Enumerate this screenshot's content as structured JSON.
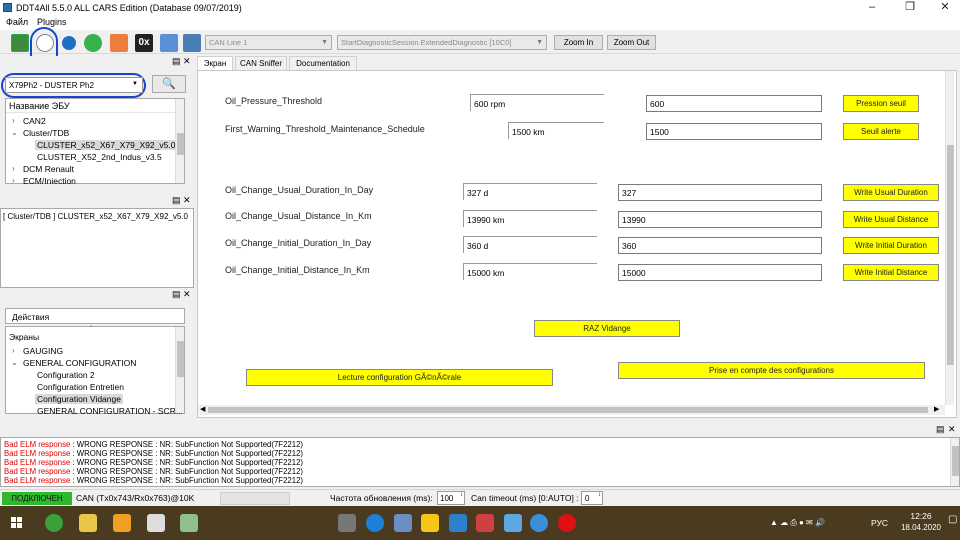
{
  "window": {
    "title": "DDT4All 5.5.0 ALL CARS Edition (Database 09/07/2019)"
  },
  "menu": {
    "file": "Файл",
    "plugins": "Plugins"
  },
  "toolbar": {
    "can_line": "CAN Line 1",
    "session": "StartDiagnosticSession.ExtendedDiagnostic [10C0]",
    "zoom_in": "Zoom In",
    "zoom_out": "Zoom Out",
    "hex_label": "0x"
  },
  "left": {
    "vehicle_select": "X79Ph2 - DUSTER Ph2",
    "ecu_header": "Название ЭБУ",
    "ecu_tree": [
      "CAN2",
      "Cluster/TDB",
      "CLUSTER_x52_X67_X79_X92_v5.0",
      "CLUSTER_X52_2nd_Indus_v3.5",
      "DCM Renault",
      "ECM/Injection"
    ],
    "selected_ecu": "[ Cluster/TDB ] CLUSTER_x52_X67_X79_X92_v5.0",
    "actions_header": "Действия",
    "screens_header": "Экраны",
    "screens": [
      "GAUGING",
      "GENERAL CONFIGURATION",
      "Configuration 2",
      "Configuration Entretien",
      "Configuration Vidange",
      "GENERAL CONFIGURATION - SCR..."
    ]
  },
  "tabs": [
    "Экран",
    "CAN Sniffer",
    "Documentation"
  ],
  "main": {
    "rows": [
      {
        "label": "Oil_Pressure_Threshold",
        "value": "600 rpm",
        "input": "600",
        "button": "Pression seuil"
      },
      {
        "label": "First_Warning_Threshold_Maintenance_Schedule",
        "value": "1500 km",
        "input": "1500",
        "button": "Seuil alerte"
      },
      {
        "label": "Oil_Change_Usual_Duration_In_Day",
        "value": "327 d",
        "input": "327",
        "button": "Write Usual Duration"
      },
      {
        "label": "Oil_Change_Usual_Distance_In_Km",
        "value": "13990 km",
        "input": "13990",
        "button": "Write Usual Distance"
      },
      {
        "label": "Oil_Change_Initial_Duration_In_Day",
        "value": "360 d",
        "input": "360",
        "button": "Write Initial Duration"
      },
      {
        "label": "Oil_Change_Initial_Distance_In_Km",
        "value": "15000 km",
        "input": "15000",
        "button": "Write Initial Distance"
      }
    ],
    "raz_button": "RAZ Vidange",
    "lecture_button": "Lecture configuration GÃ©nÃ©rale",
    "prise_button": "Prise en compte des configurations"
  },
  "log": {
    "lines": [
      {
        "tag": "Bad ELM response",
        "text": " : WRONG RESPONSE : NR: SubFunction Not Supported(7F2212)"
      },
      {
        "tag": "Bad ELM response",
        "text": " : WRONG RESPONSE : NR: SubFunction Not Supported(7F2212)"
      },
      {
        "tag": "Bad ELM response",
        "text": " : WRONG RESPONSE : NR: SubFunction Not Supported(7F2212)"
      },
      {
        "tag": "Bad ELM response",
        "text": " : WRONG RESPONSE : NR: SubFunction Not Supported(7F2212)"
      },
      {
        "tag": "Bad ELM response",
        "text": " : WRONG RESPONSE : NR: SubFunction Not Supported(7F2212)"
      }
    ]
  },
  "status": {
    "connected": "ПОДКЛЮЧЕН",
    "can_info": "CAN (Tx0x743/Rx0x763)@10K",
    "refresh_label": "Частота обновления (ms):",
    "refresh_value": "100",
    "can_timeout_label": "Can timeout (ms) [0:AUTO] :",
    "can_timeout_value": "0",
    "connected_color": "#2eb82e"
  },
  "taskbar": {
    "time": "12:26",
    "date": "18.04.2020",
    "lang": "РУС"
  }
}
